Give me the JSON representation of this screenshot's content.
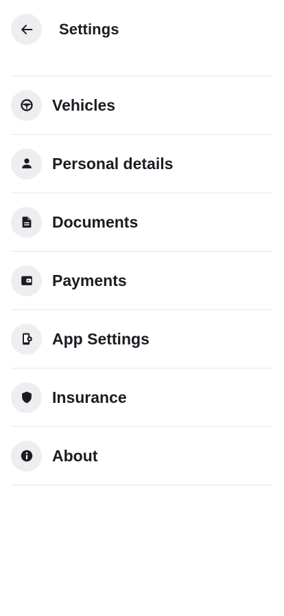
{
  "header": {
    "title": "Settings",
    "back_icon": "arrow-left-icon"
  },
  "menu": {
    "items": [
      {
        "label": "Vehicles",
        "icon": "steering-wheel-icon"
      },
      {
        "label": "Personal details",
        "icon": "person-icon"
      },
      {
        "label": "Documents",
        "icon": "document-icon"
      },
      {
        "label": "Payments",
        "icon": "wallet-icon"
      },
      {
        "label": "App Settings",
        "icon": "phone-settings-icon"
      },
      {
        "label": "Insurance",
        "icon": "shield-icon"
      },
      {
        "label": "About",
        "icon": "info-icon"
      }
    ]
  },
  "colors": {
    "text": "#1c1b22",
    "icon_background": "#eeeef1",
    "divider": "#e8e8ec",
    "background": "#ffffff"
  }
}
